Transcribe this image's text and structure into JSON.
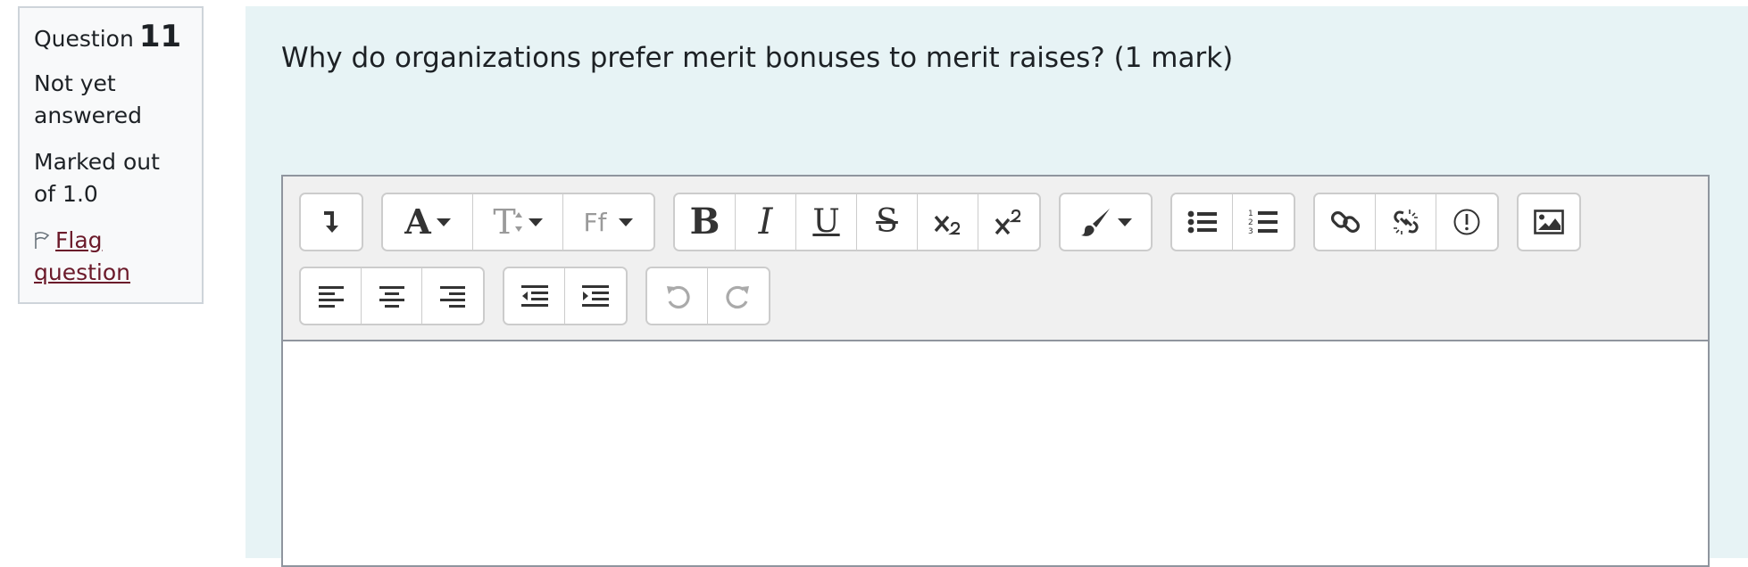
{
  "question_info": {
    "question_label": "Question",
    "question_number": "11",
    "state": "Not yet answered",
    "grade": "Marked out of 1.0",
    "flag_label": "Flag question"
  },
  "question_text": "Why do organizations prefer merit bonuses to merit raises? (1 mark)",
  "editor": {
    "toolbar": {
      "bold": "B",
      "italic": "I",
      "underline": "U",
      "strikethrough": "S",
      "font_color_letter": "A",
      "font_size_letter": "T",
      "font_family_letters": "Ff"
    },
    "content": ""
  }
}
